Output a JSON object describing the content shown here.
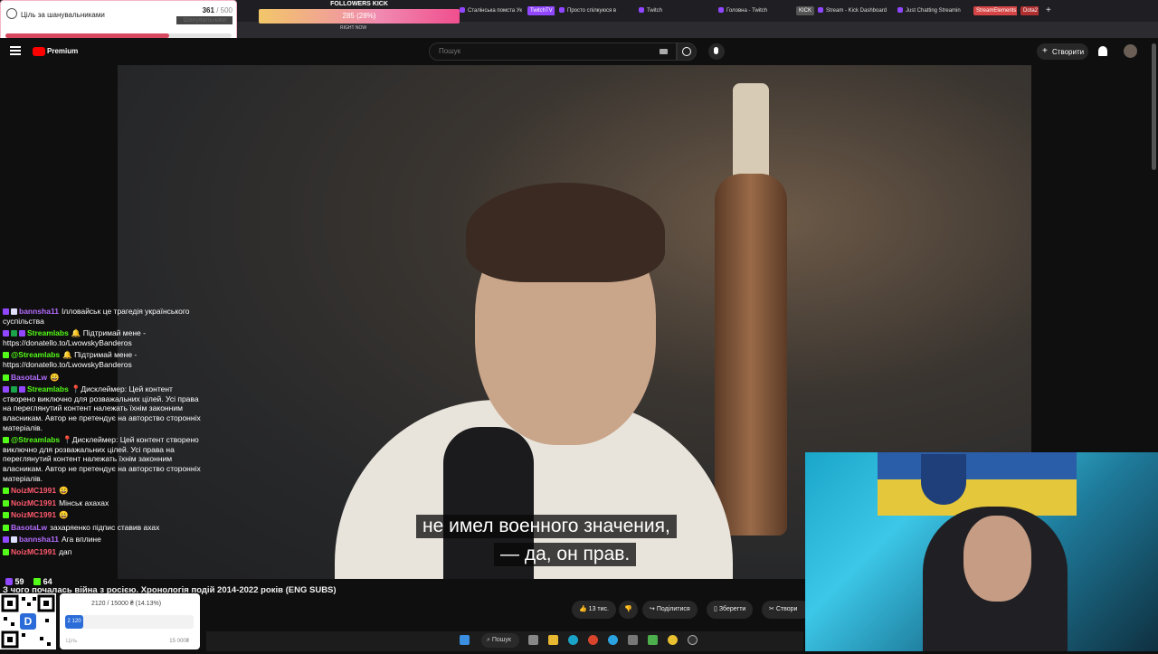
{
  "browser": {
    "tabs": [
      {
        "label": "Сталінська помста Ук",
        "type": "tab"
      },
      {
        "label": "TwitchTV",
        "type": "pill",
        "color": "#9146ff"
      },
      {
        "label": "Просто спілкуюся в",
        "type": "tab"
      },
      {
        "label": "Twitch",
        "type": "tab"
      },
      {
        "label": "Головна - Twitch",
        "type": "tab"
      },
      {
        "label": "KICK",
        "type": "pill",
        "color": "#555555"
      },
      {
        "label": "Stream - Kick Dashboard",
        "type": "tab"
      },
      {
        "label": "Just Chatting Streamin",
        "type": "tab"
      },
      {
        "label": "StreamElements",
        "type": "pill",
        "color": "#d64545"
      },
      {
        "label": "Dota2",
        "type": "pill",
        "color": "#b03030"
      }
    ],
    "new_tab": "+"
  },
  "goal_widget": {
    "title": "Ціль за шанувальниками",
    "current": "361",
    "target": "/ 500",
    "subtitle": "Шанувальники",
    "progress": 0.722
  },
  "followers_kick": {
    "label": "FOLLOWERS KICK",
    "value": "285 (28%)",
    "right_now": "RIGHT NOW",
    "progress": 0.28
  },
  "youtube": {
    "logo": "Premium",
    "search_placeholder": "Пошук",
    "create_label": "Створити"
  },
  "subtitles": {
    "line1": "не имел военного значения,",
    "line2": "— да, он прав."
  },
  "chat": [
    {
      "nick": "bannsha11",
      "color": "#b56cff",
      "badges": [
        "#9146ff",
        "#e0e0ff"
      ],
      "text": "Ілловайськ це трагедія українського суспільства"
    },
    {
      "nick": "Streamlabs",
      "color": "#53fc18",
      "badges": [
        "#9146ff",
        "#1aa34a",
        "#9146ff"
      ],
      "text": "🔔 Підтримай мене - https://donatello.to/LwowskyBanderos"
    },
    {
      "nick": "@Streamlabs",
      "color": "#53fc18",
      "badges": [
        "#53fc18"
      ],
      "text": "🔔 Підтримай мене - https://donatello.to/LwowskyBanderos"
    },
    {
      "nick": "BasotaLw",
      "color": "#b56cff",
      "badges": [
        "#53fc18"
      ],
      "text": "😀"
    },
    {
      "nick": "Streamlabs",
      "color": "#53fc18",
      "badges": [
        "#9146ff",
        "#1aa34a",
        "#9146ff"
      ],
      "text": "📍Дисклеймер: Цей контент створено виключно для розважальних цілей. Усі права на переглянутий контент належать їхнім законним власникам. Автор не претендує на авторство сторонніх матеріалів."
    },
    {
      "nick": "@Streamlabs",
      "color": "#53fc18",
      "badges": [
        "#53fc18"
      ],
      "text": "📍Дисклеймер: Цей контент створено виключно для розважальних цілей. Усі права на переглянутий контент належать їхнім законним власникам. Автор не претендує на авторство сторонніх матеріалів."
    },
    {
      "nick": "NoizMC1991",
      "color": "#ff5a6e",
      "badges": [
        "#53fc18"
      ],
      "text": "😀"
    },
    {
      "nick": "NoizMC1991",
      "color": "#ff5a6e",
      "badges": [
        "#53fc18"
      ],
      "text": "Мінськ ахахах"
    },
    {
      "nick": "NoizMC1991",
      "color": "#ff5a6e",
      "badges": [
        "#53fc18"
      ],
      "text": "😀"
    },
    {
      "nick": "BasotaLw",
      "color": "#b56cff",
      "badges": [
        "#53fc18"
      ],
      "text": "захаряенко підпис ставив ахах"
    },
    {
      "nick": "bannsha11",
      "color": "#b56cff",
      "badges": [
        "#9146ff",
        "#e0e0ff"
      ],
      "text": "Ага вплине"
    },
    {
      "nick": "NoizMC1991",
      "color": "#ff5a6e",
      "badges": [
        "#53fc18"
      ],
      "text": "дап"
    }
  ],
  "viewer_counts": {
    "twitch": "59",
    "kick": "64"
  },
  "video_title": "З чого почалась війна з росією. Хронологія подій 2014-2022 років (ENG SUBS)",
  "actions": {
    "likes": "13 тис.",
    "share": "Поділитися",
    "save": "Зберегти",
    "create": "Створи"
  },
  "donation_widget": {
    "progress_text": "2120 / 15000 ₴ (14.13%)",
    "bar_value": "2 120",
    "progress": 0.1413,
    "goal_label": "Ціль",
    "goal_amount": "15 000₴"
  },
  "taskbar": {
    "search": "Пошук"
  }
}
